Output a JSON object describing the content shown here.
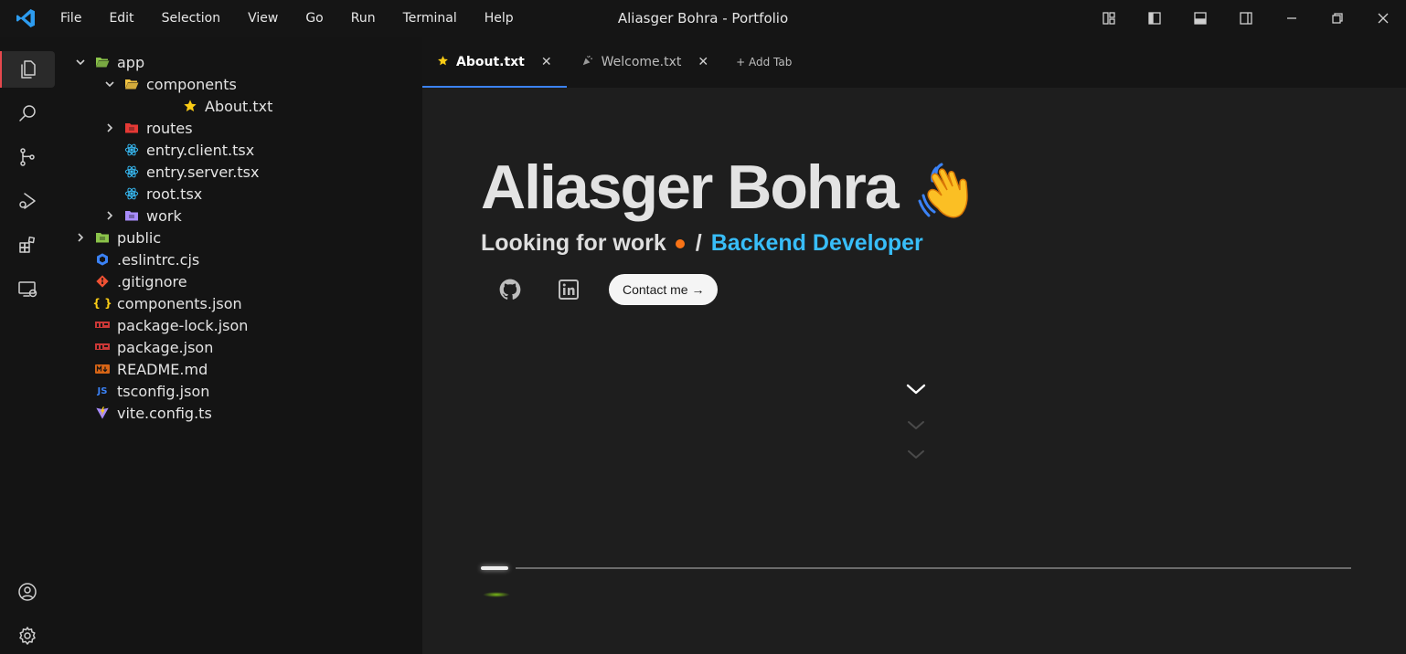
{
  "window": {
    "title": "Aliasger Bohra - Portfolio",
    "menu": [
      "File",
      "Edit",
      "Selection",
      "View",
      "Go",
      "Run",
      "Terminal",
      "Help"
    ]
  },
  "explorer": {
    "items": [
      {
        "label": "app",
        "level": 0,
        "kind": "folder-open",
        "expanded": true,
        "icon_color": "#8bc34a"
      },
      {
        "label": "components",
        "level": 1,
        "kind": "folder-open",
        "expanded": true,
        "icon_color": "#f4c542"
      },
      {
        "label": "About.txt",
        "level": 3,
        "kind": "file-star",
        "icon_color": "#facc15"
      },
      {
        "label": "routes",
        "level": 1,
        "kind": "folder",
        "expanded": false,
        "icon_color": "#e53935"
      },
      {
        "label": "entry.client.tsx",
        "level": 1,
        "kind": "react",
        "icon_color": "#38bdf8"
      },
      {
        "label": "entry.server.tsx",
        "level": 1,
        "kind": "react",
        "icon_color": "#38bdf8"
      },
      {
        "label": "root.tsx",
        "level": 1,
        "kind": "react",
        "icon_color": "#38bdf8"
      },
      {
        "label": "work",
        "level": 1,
        "kind": "folder",
        "expanded": false,
        "icon_color": "#a78bfa"
      },
      {
        "label": "public",
        "level": 0,
        "kind": "folder",
        "expanded": false,
        "icon_color": "#8bc34a"
      },
      {
        "label": ".eslintrc.cjs",
        "level": 0,
        "kind": "eslint",
        "icon_color": "#3b82f6"
      },
      {
        "label": ".gitignore",
        "level": 0,
        "kind": "git",
        "icon_color": "#f05133"
      },
      {
        "label": "components.json",
        "level": 0,
        "kind": "json",
        "icon_color": "#facc15"
      },
      {
        "label": "package-lock.json",
        "level": 0,
        "kind": "npm",
        "icon_color": "#cb3837"
      },
      {
        "label": "package.json",
        "level": 0,
        "kind": "npm",
        "icon_color": "#cb3837"
      },
      {
        "label": "README.md",
        "level": 0,
        "kind": "md",
        "icon_color": "#f97316"
      },
      {
        "label": "tsconfig.json",
        "level": 0,
        "kind": "js",
        "icon_color": "#3b82f6"
      },
      {
        "label": "vite.config.ts",
        "level": 0,
        "kind": "vite",
        "icon_color": "#a78bfa"
      }
    ]
  },
  "tabs": [
    {
      "label": "About.txt",
      "icon": "star-icon",
      "active": true
    },
    {
      "label": "Welcome.txt",
      "icon": "party-icon",
      "active": false
    }
  ],
  "add_tab_label": "+ Add Tab",
  "hero": {
    "name": "Aliasger Bohra",
    "status": "Looking for work",
    "separator": "/",
    "role": "Backend Developer",
    "contact_label": "Contact me →"
  },
  "colors": {
    "accent": "#3b82f6",
    "status_dot": "#f97316",
    "role": "#38bdf8"
  }
}
